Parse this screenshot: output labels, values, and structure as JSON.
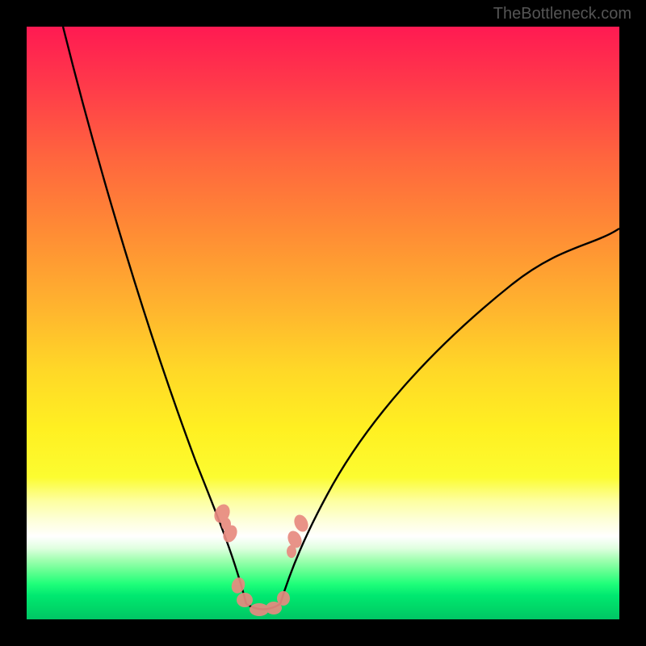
{
  "watermark": "TheBottleneck.com",
  "chart_data": {
    "type": "line",
    "title": "",
    "xlabel": "",
    "ylabel": "",
    "xlim": [
      0,
      100
    ],
    "ylim": [
      0,
      100
    ],
    "background_gradient": {
      "top": "#ff1a52",
      "mid": "#fff022",
      "bottom_band": "#00d868"
    },
    "series": [
      {
        "name": "left-branch",
        "color": "#000000",
        "x": [
          6,
          10,
          14,
          18,
          22,
          26,
          30,
          32,
          34,
          36,
          37
        ],
        "y": [
          100,
          82,
          66,
          52,
          40,
          29,
          19,
          14,
          10,
          6,
          3
        ]
      },
      {
        "name": "right-branch",
        "color": "#000000",
        "x": [
          43,
          45,
          48,
          52,
          58,
          66,
          76,
          88,
          100
        ],
        "y": [
          3,
          6,
          10,
          16,
          24,
          34,
          45,
          56,
          66
        ]
      },
      {
        "name": "valley-floor",
        "color": "#000000",
        "x": [
          37,
          40,
          43
        ],
        "y": [
          3,
          1,
          3
        ]
      }
    ],
    "annotations": [
      {
        "name": "marker-cluster-left",
        "shape": "blob",
        "color": "#e88a80",
        "approx_x": 34,
        "approx_y": 8
      },
      {
        "name": "marker-cluster-right",
        "shape": "blob",
        "color": "#e88a80",
        "approx_x": 45,
        "approx_y": 8
      },
      {
        "name": "marker-cluster-bottom",
        "shape": "blob",
        "color": "#e88a80",
        "approx_x": 39,
        "approx_y": 1.5
      }
    ]
  }
}
